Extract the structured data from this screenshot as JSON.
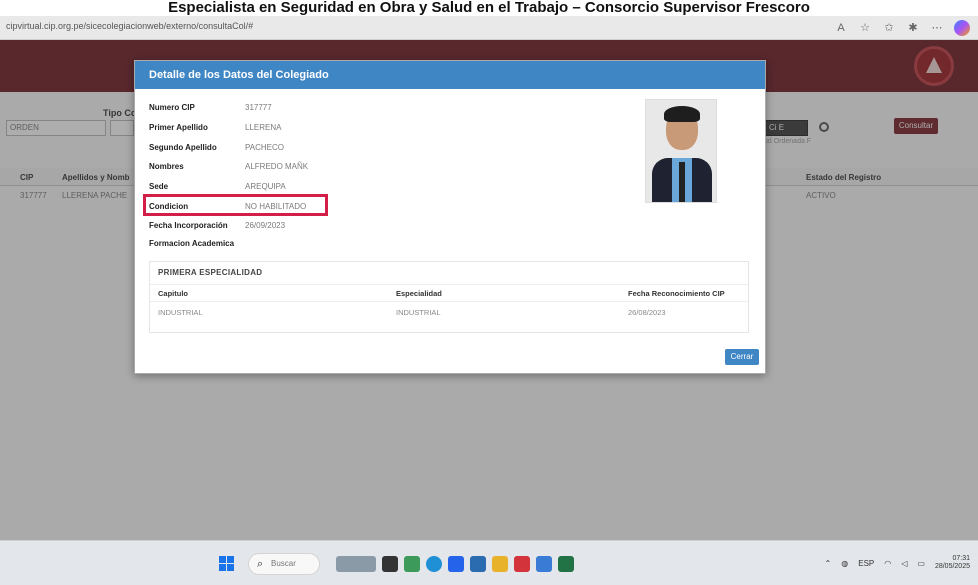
{
  "document": {
    "heading": "Especialista en Seguridad en Obra y Salud en el Trabajo – Consorcio Supervisor Frescoro"
  },
  "browser": {
    "url": "cipvirtual.cip.org.pe/sicecolegiacionweb/externo/consultaCol/#"
  },
  "page": {
    "filter_label": "Tipo Co",
    "filter_select": "ORDEN",
    "search_value": "Ci E",
    "search_hint": "ud Ordenada F",
    "consult_label": "Consultar",
    "table_headers": {
      "cip": "CIP",
      "nombres": "Apellidos y Nomb",
      "estado": "Estado del Registro"
    },
    "row": {
      "cip": "317777",
      "nombres": "LLERENA PACHE",
      "estado": "ACTIVO"
    }
  },
  "modal": {
    "title": "Detalle de los Datos del Colegiado",
    "fields": [
      {
        "label": "Numero CIP",
        "value": "317777"
      },
      {
        "label": "Primer Apellido",
        "value": "LLERENA"
      },
      {
        "label": "Segundo Apellido",
        "value": "PACHECO"
      },
      {
        "label": "Nombres",
        "value": "ALFREDO MAÑK"
      },
      {
        "label": "Sede",
        "value": "AREQUIPA"
      },
      {
        "label": "Condicion",
        "value": "NO HABILITADO"
      },
      {
        "label": "Fecha Incorporación",
        "value": "26/09/2023"
      }
    ],
    "section_title": "Formacion Academica",
    "specialty": {
      "title": "PRIMERA ESPECIALIDAD",
      "headers": {
        "capitulo": "Capitulo",
        "especialidad": "Especialidad",
        "fecha": "Fecha Reconocimiento CIP"
      },
      "row": {
        "capitulo": "INDUSTRIAL",
        "especialidad": "INDUSTRIAL",
        "fecha": "26/08/2023"
      }
    },
    "close_label": "Cerrar"
  },
  "taskbar": {
    "search_placeholder": "Buscar",
    "lang": "ESP",
    "time": "07:31",
    "date": "28/05/2025"
  },
  "colors": {
    "header_maroon": "#6d1b23",
    "modal_blue": "#3f86c5",
    "highlight_red": "#d31f47"
  }
}
